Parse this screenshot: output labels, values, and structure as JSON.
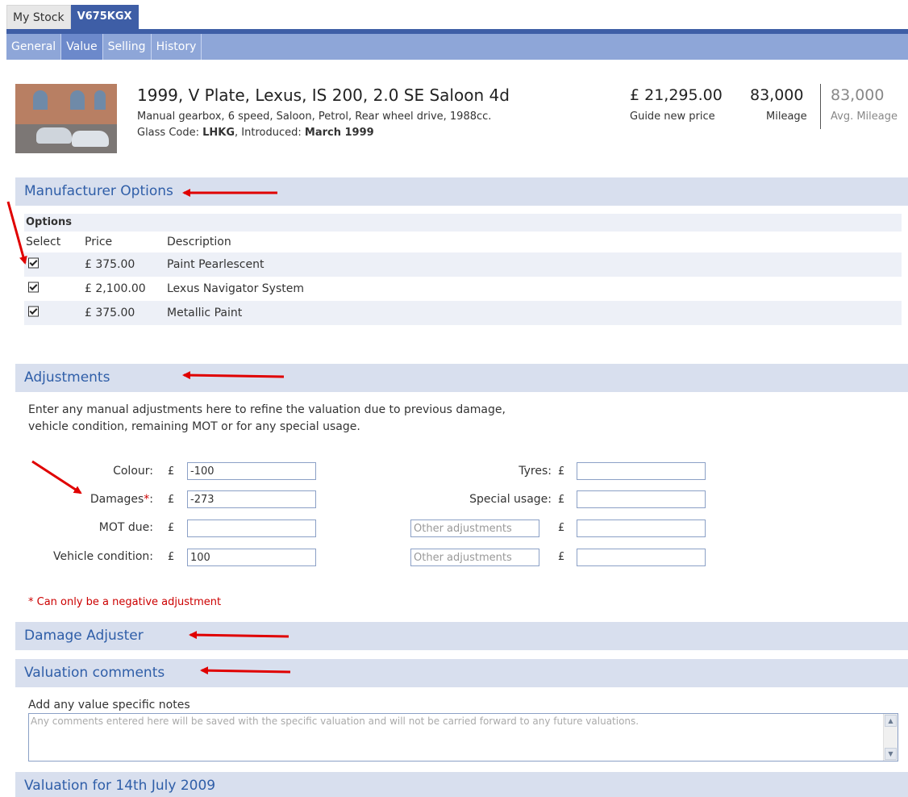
{
  "top_tabs": {
    "my_stock": "My Stock",
    "registration": "V675KGX"
  },
  "sub_tabs": [
    "General",
    "Value",
    "Selling",
    "History"
  ],
  "vehicle": {
    "title": "1999, V Plate, Lexus, IS 200, 2.0 SE Saloon 4d",
    "spec": "Manual gearbox, 6 speed, Saloon, Petrol, Rear wheel drive, 1988cc.",
    "glass_prefix": "Glass Code: ",
    "glass_code": "LHKG",
    "introduced_prefix": ", Introduced: ",
    "introduced": "March 1999"
  },
  "stats": {
    "guide_price": "£ 21,295.00",
    "guide_label": "Guide new price",
    "mileage": "83,000",
    "mileage_label": "Mileage",
    "avg_mileage": "83,000",
    "avg_mileage_label": "Avg. Mileage"
  },
  "sections": {
    "manufacturer_options": "Manufacturer Options",
    "adjustments": "Adjustments",
    "damage_adjuster": "Damage Adjuster",
    "valuation_comments": "Valuation comments",
    "valuation_for": "Valuation for 14th July 2009"
  },
  "options": {
    "caption": "Options",
    "headers": {
      "select": "Select",
      "price": "Price",
      "description": "Description"
    },
    "rows": [
      {
        "checked": true,
        "price": "£ 375.00",
        "description": "Paint Pearlescent"
      },
      {
        "checked": true,
        "price": "£ 2,100.00",
        "description": "Lexus Navigator System"
      },
      {
        "checked": true,
        "price": "£ 375.00",
        "description": "Metallic Paint"
      }
    ]
  },
  "adjustments": {
    "intro_line1": "Enter any manual adjustments here to refine the valuation due to previous damage,",
    "intro_line2": "vehicle condition, remaining MOT or for any special usage.",
    "currency": "£",
    "required_mark": "*",
    "colour_label": "Colour:",
    "colour_value": "-100",
    "damages_label": "Damages",
    "damages_colon": ":",
    "damages_value": "-273",
    "mot_label": "MOT due:",
    "mot_value": "",
    "condition_label": "Vehicle condition:",
    "condition_value": "100",
    "tyres_label": "Tyres:",
    "tyres_value": "",
    "special_label": "Special usage:",
    "special_value": "",
    "other_placeholder": "Other adjustments",
    "other1_value": "",
    "other2_value": "",
    "negative_note": "* Can only be a negative adjustment"
  },
  "comments": {
    "label": "Add any value specific notes",
    "placeholder": "Any comments entered here will be saved with the specific valuation and will not be carried forward to any future valuations."
  },
  "colors": {
    "nav_blue": "#3e5ea6",
    "subnav_blue": "#8ea6d8",
    "section_bg": "#d8dfee",
    "section_title": "#2f5ea8",
    "annotation_red": "#e00000"
  },
  "icons": {
    "scroll_up": "▲",
    "scroll_down": "▼"
  }
}
